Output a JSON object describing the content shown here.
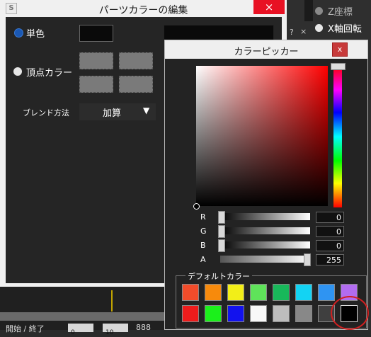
{
  "background": {
    "radios": [
      {
        "label": "Z座標",
        "color": "#8a8a8a"
      },
      {
        "label": "X軸回転",
        "color": "#e8e8e8"
      }
    ],
    "close_glyphs": [
      "?",
      "×"
    ]
  },
  "editor": {
    "title": "パーツカラーの編集",
    "icon_letter": "S",
    "close": "×",
    "mode_single": "単色",
    "mode_vertex": "頂点カラー",
    "blend_label": "ブレンド方法",
    "blend_value": "加算",
    "blend_arrow": "▼"
  },
  "timeline": {
    "label": "開始 / 終了",
    "box_start": "0",
    "box_end": "10",
    "extra": "888"
  },
  "picker": {
    "title": "カラーピッカー",
    "close": "x",
    "sliders": [
      {
        "label": "R",
        "value": "0",
        "level": 0
      },
      {
        "label": "G",
        "value": "0",
        "level": 0
      },
      {
        "label": "B",
        "value": "0",
        "level": 0
      },
      {
        "label": "A",
        "value": "255",
        "level": 1
      }
    ],
    "default_colors_label": "デフォルトカラー",
    "default_colors": [
      "#f24c2a",
      "#f78a0c",
      "#f2ee18",
      "#5fe35a",
      "#18b85a",
      "#13d3f3",
      "#2f94f2",
      "#b26cf0",
      "#ee1c1c",
      "#1bf01b",
      "#1212ee",
      "#f8f8f8",
      "#bdbdbd",
      "#888888",
      "#3f3f3f",
      "#000000"
    ]
  },
  "colors": {
    "accent_red": "#e81123",
    "highlight_circle": "#d02020"
  }
}
